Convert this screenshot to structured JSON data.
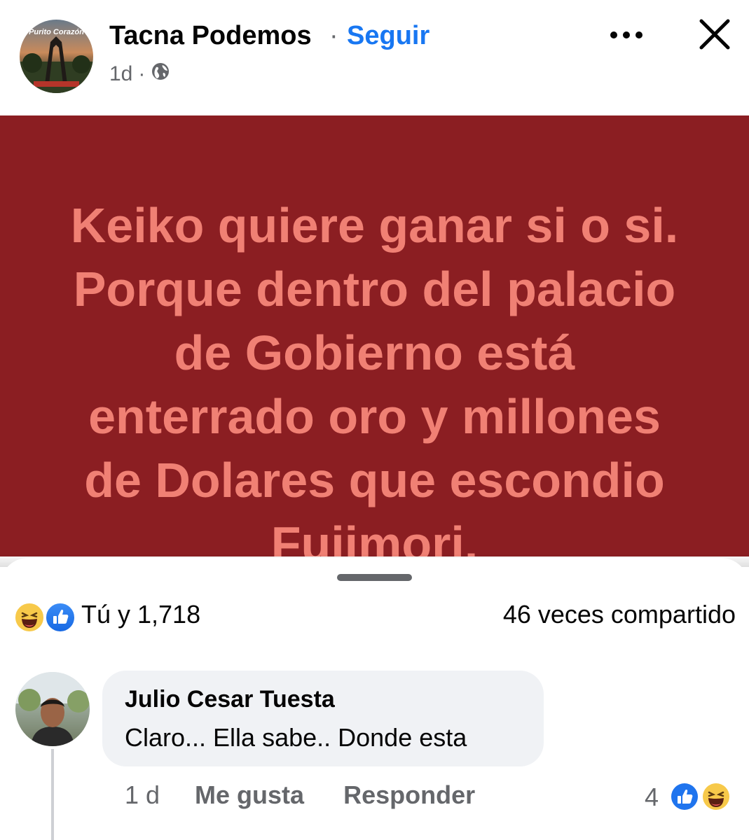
{
  "header": {
    "page_name": "Tacna Podemos",
    "separator": "·",
    "follow_label": "Seguir",
    "time": "1d",
    "meta_separator": "·",
    "privacy_icon": "globe-icon",
    "more_icon": "more-horizontal-icon",
    "close_icon": "close-icon",
    "avatar_caption": "Purito Corazón"
  },
  "post": {
    "background_color": "#8b1e22",
    "text_color": "#f08074",
    "text": "Keiko quiere ganar si o si.\nPorque dentro del palacio\nde Gobierno está\nenterrado oro y millones\nde Dolares que escondio\nFujimori."
  },
  "summary": {
    "reaction_icons": [
      "haha-icon",
      "like-icon"
    ],
    "reactions_text": "Tú y 1,718",
    "shares_text": "46 veces compartido"
  },
  "comment": {
    "author": "Julio Cesar Tuesta",
    "text": "Claro... Ella sabe.. Donde esta",
    "time": "1 d",
    "like_label": "Me gusta",
    "reply_label": "Responder",
    "reaction_count": "4",
    "reaction_icons": [
      "like-icon",
      "haha-icon"
    ]
  },
  "colors": {
    "accent": "#1877f2",
    "secondary_text": "#65676b"
  }
}
